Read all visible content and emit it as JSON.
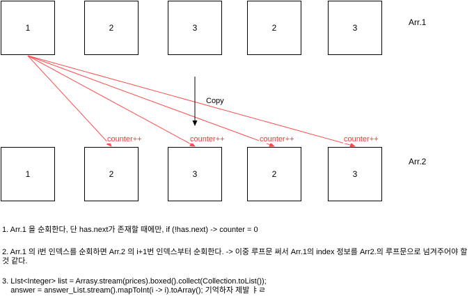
{
  "arr1": {
    "label": "Arr.1",
    "cells": [
      "1",
      "2",
      "3",
      "2",
      "3"
    ]
  },
  "arr2": {
    "label": "Arr.2",
    "cells": [
      "1",
      "2",
      "3",
      "2",
      "3"
    ]
  },
  "copy_label": "Copy",
  "edge_labels": [
    "counter++",
    "counter++",
    "counter++",
    "counter++"
  ],
  "colors": {
    "arrow": "#ff4d4d",
    "edge_label": "#ff3333",
    "box_border": "#000000"
  },
  "notes": [
    "1. Arr.1 을 순회한다, 단 has.next가 존재할 때에만, if (!has.next) -> counter = 0",
    "2. Arr.1 의 i번 인덱스를 순회하면 Arr.2 의 i+1번 인덱스부터 순회한다. -> 이중 루프문 써서 Arr.1의 index 정보를 Arr2.의 루프문으로 넘겨주어야 할 것 같다.",
    "3. LIst<Integer> list = Arrasy.stream(prices).boxed().collect(Collection.toList());\n    answer = answer_List.stream().mapToInt(i -> i).toArray(); 기억하자 제발 ㅑㄹ"
  ]
}
